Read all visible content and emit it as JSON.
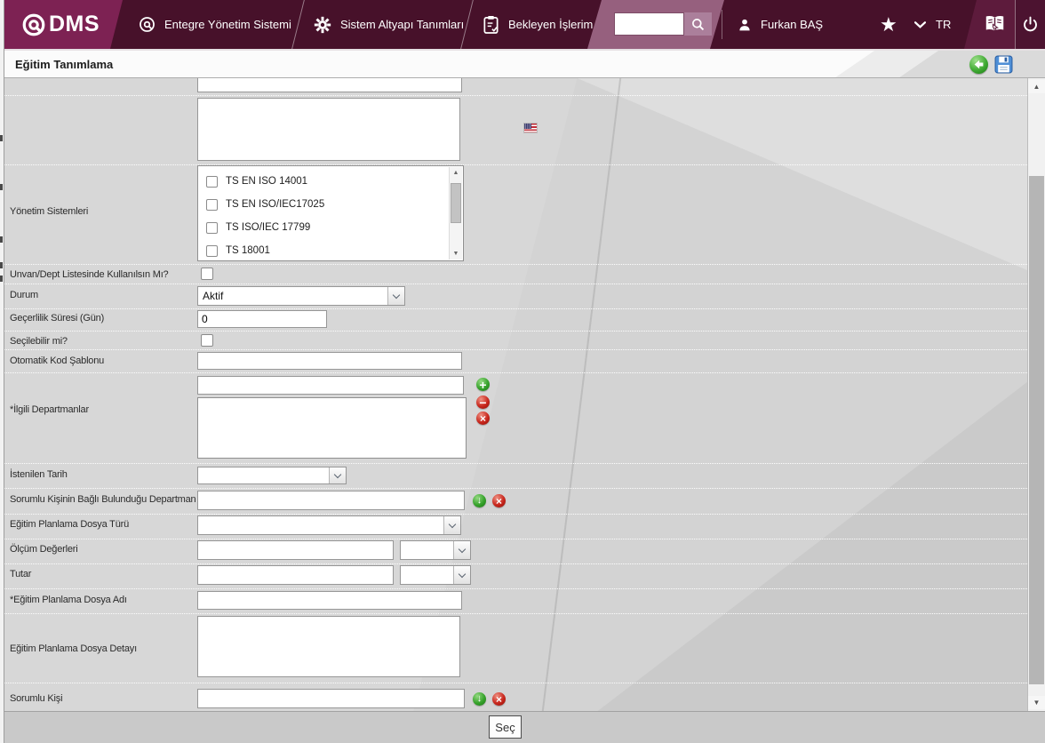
{
  "colors": {
    "topbar_bg": "#47112a",
    "logo_bg": "#7d2253",
    "search_panel_bg": "#96607e",
    "help_panel_bg": "#5d1b3c",
    "accent_green": "#2f9e28",
    "accent_red": "#c0251c",
    "save_blue": "#4f8fd6"
  },
  "topbar": {
    "logo_text": "DMS",
    "menu": [
      {
        "label": "Entegre Yönetim Sistemi"
      },
      {
        "label": "Sistem Altyapı Tanımları"
      },
      {
        "label": "Bekleyen İşlerim"
      }
    ],
    "search": {
      "value": ""
    },
    "user_name": "Furkan BAŞ",
    "language": "TR"
  },
  "titlebar": {
    "title": "Eğitim Tanımlama"
  },
  "form": {
    "top_input_value": "",
    "description_value": "",
    "management_systems": {
      "label": "Yönetim Sistemleri",
      "options": [
        {
          "label": "TS EN ISO 14001",
          "checked": false
        },
        {
          "label": "TS EN ISO/IEC17025",
          "checked": false
        },
        {
          "label": "TS ISO/IEC 17799",
          "checked": false
        },
        {
          "label": "TS 18001",
          "checked": false
        }
      ]
    },
    "fields": {
      "unvan_dept": {
        "label": "Unvan/Dept Listesinde Kullanılsın Mı?",
        "checked": false
      },
      "durum": {
        "label": "Durum",
        "value": "Aktif"
      },
      "gecerlilik_suresi": {
        "label": "Geçerlilik Süresi (Gün)",
        "value": "0"
      },
      "secilebilir": {
        "label": "Seçilebilir mi?",
        "checked": false
      },
      "otomatik_kod": {
        "label": "Otomatik Kod Şablonu",
        "value": ""
      },
      "ilgili_departmanlar": {
        "label": "*İlgili Departmanlar",
        "value": ""
      },
      "istenilen_tarih": {
        "label": "İstenilen Tarih",
        "value": ""
      },
      "sorumlu_departman": {
        "label": "Sorumlu Kişinin Bağlı Bulunduğu Departman",
        "value": ""
      },
      "dosya_turu": {
        "label": "Eğitim Planlama Dosya Türü",
        "value": ""
      },
      "olcum_degerleri": {
        "label": "Ölçüm Değerleri",
        "value": "",
        "unit_value": ""
      },
      "tutar": {
        "label": "Tutar",
        "value": "",
        "unit_value": ""
      },
      "dosya_adi": {
        "label": "*Eğitim Planlama Dosya Adı",
        "value": ""
      },
      "dosya_detayi": {
        "label": "Eğitim Planlama Dosya Detayı",
        "value": ""
      },
      "sorumlu_kisi": {
        "label": "Sorumlu Kişi",
        "value": ""
      }
    }
  },
  "footer": {
    "select_button": "Seç"
  },
  "icons": {
    "star": "★",
    "plus": "+",
    "minus": "−",
    "close": "×",
    "down": "↓",
    "scroll_up": "▲",
    "scroll_down": "▼"
  }
}
